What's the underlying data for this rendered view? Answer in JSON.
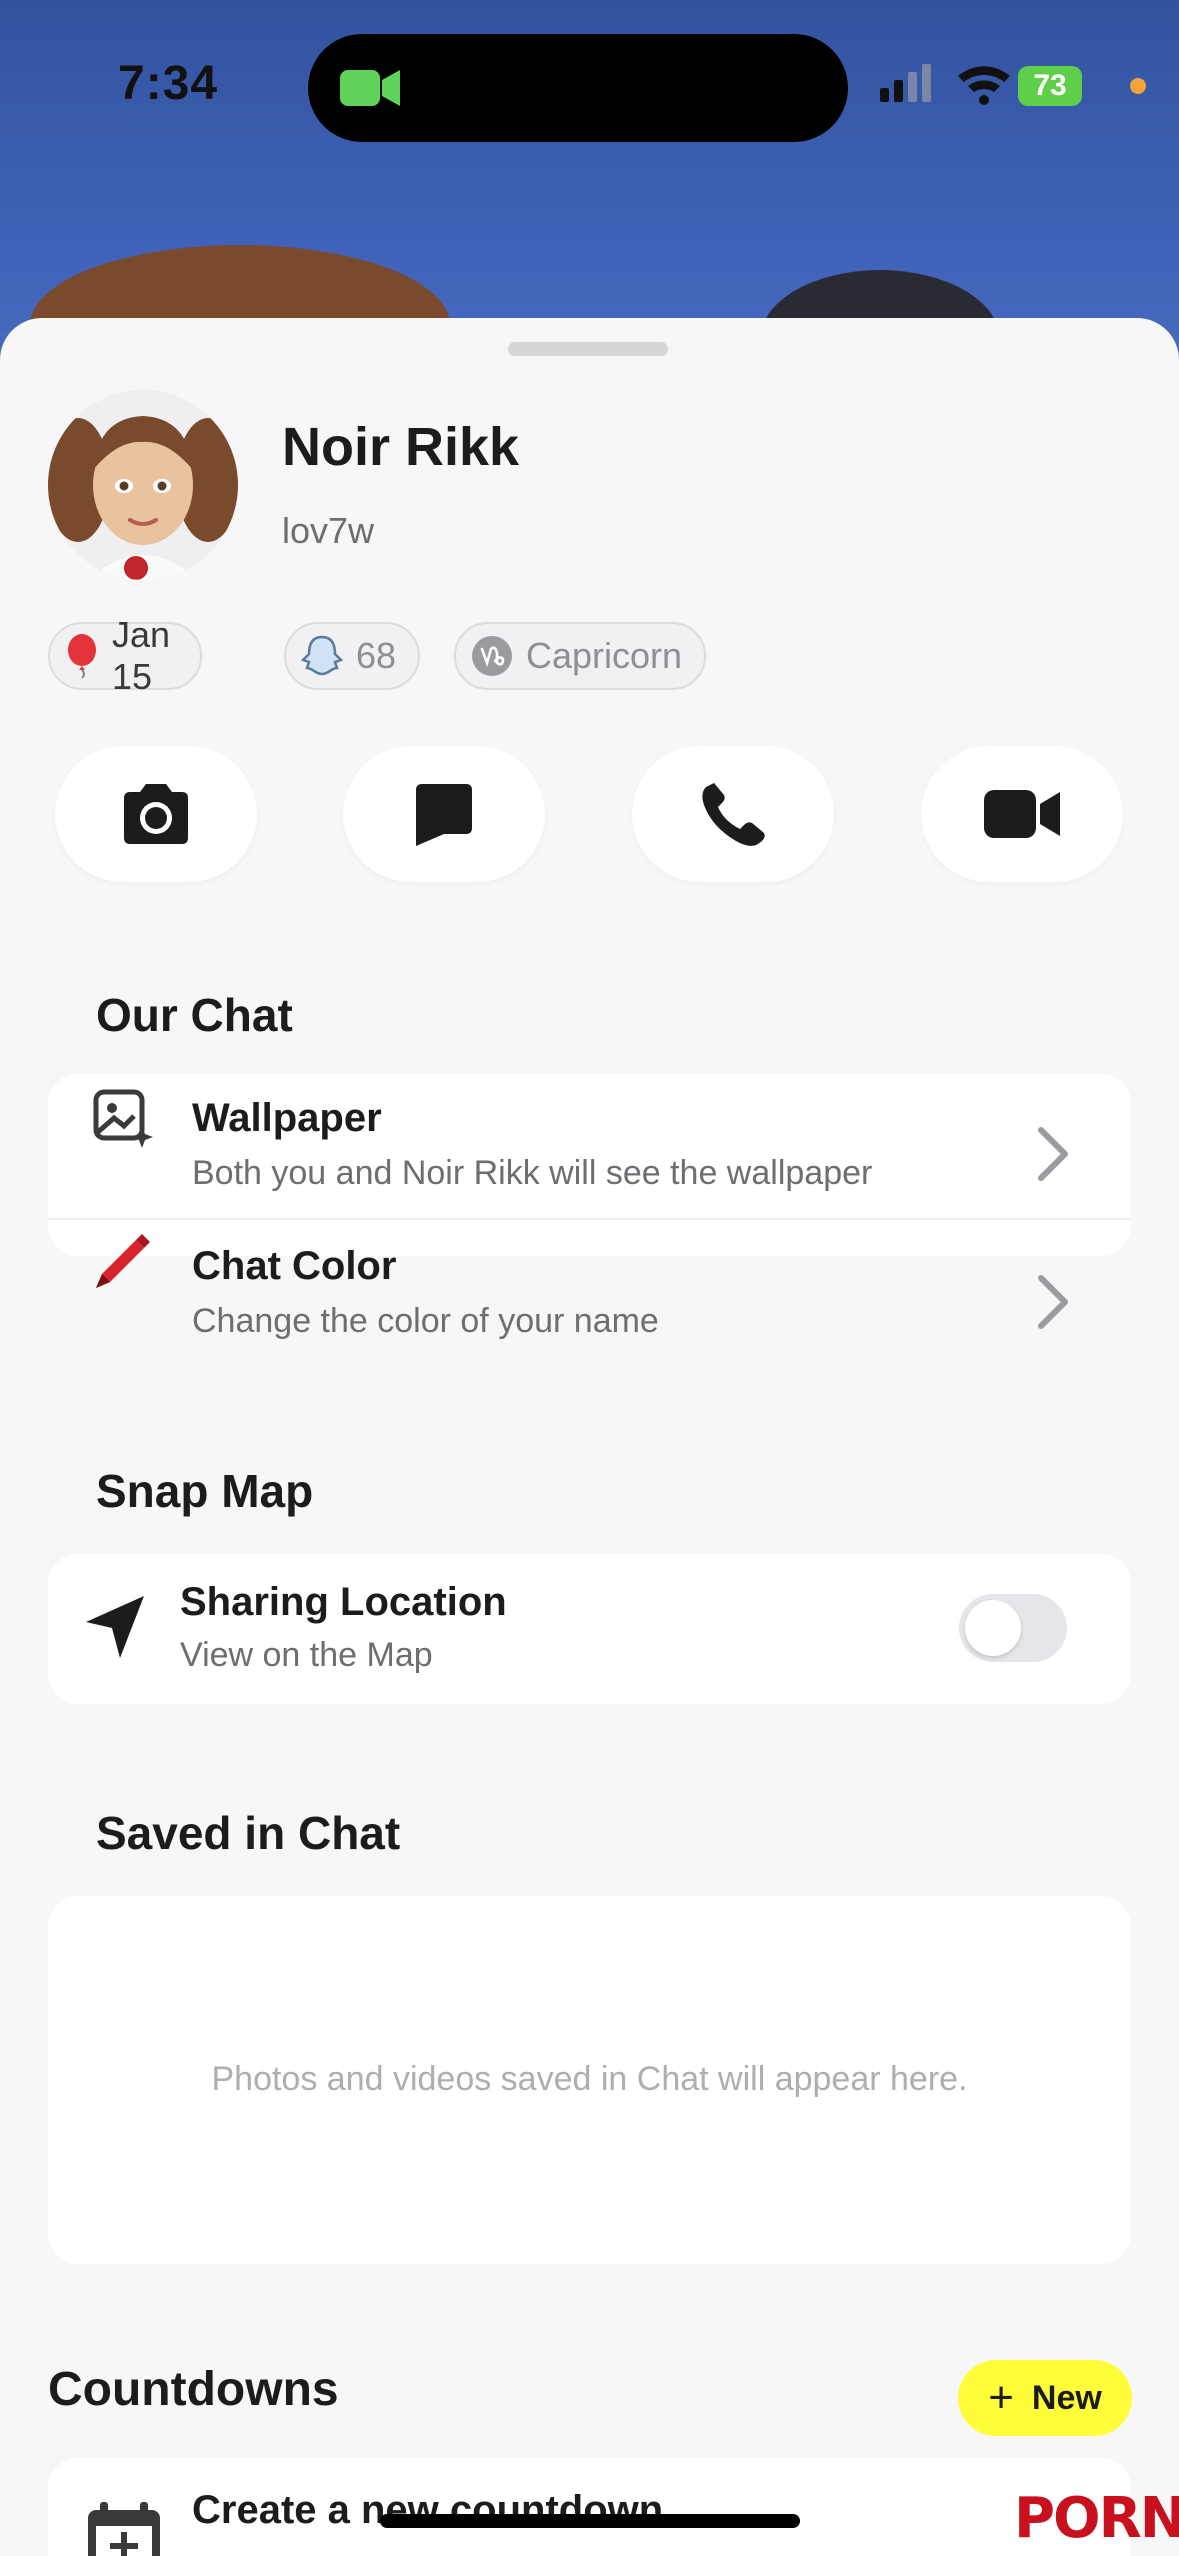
{
  "status_bar": {
    "time": "7:34",
    "battery": "73"
  },
  "profile": {
    "display_name": "Noir Rikk",
    "username": "lov7w",
    "birthday": "Jan 15",
    "snapscore": "68",
    "zodiac": "Capricorn"
  },
  "actions": [
    {
      "name": "camera",
      "icon": "camera-icon"
    },
    {
      "name": "chat",
      "icon": "chat-bubble-icon"
    },
    {
      "name": "call",
      "icon": "phone-icon"
    },
    {
      "name": "video",
      "icon": "video-camera-icon"
    }
  ],
  "our_chat": {
    "title": "Our Chat",
    "wallpaper": {
      "title": "Wallpaper",
      "subtitle": "Both you and Noir Rikk will see the wallpaper"
    },
    "chat_color": {
      "title": "Chat Color",
      "subtitle": "Change the color of your name"
    }
  },
  "snap_map": {
    "title": "Snap Map",
    "sharing": {
      "title": "Sharing Location",
      "subtitle": "View on the Map",
      "enabled": false
    }
  },
  "saved_in_chat": {
    "title": "Saved in Chat",
    "empty_text": "Photos and videos saved in Chat will appear here."
  },
  "countdowns": {
    "title": "Countdowns",
    "new_label": "New",
    "create_label": "Create a new countdown"
  },
  "overlay": {
    "watermark": "PORN"
  },
  "colors": {
    "accent_yellow": "#fffc3a",
    "crayon_red": "#d8232a",
    "battery_green": "#5fcf4b"
  }
}
